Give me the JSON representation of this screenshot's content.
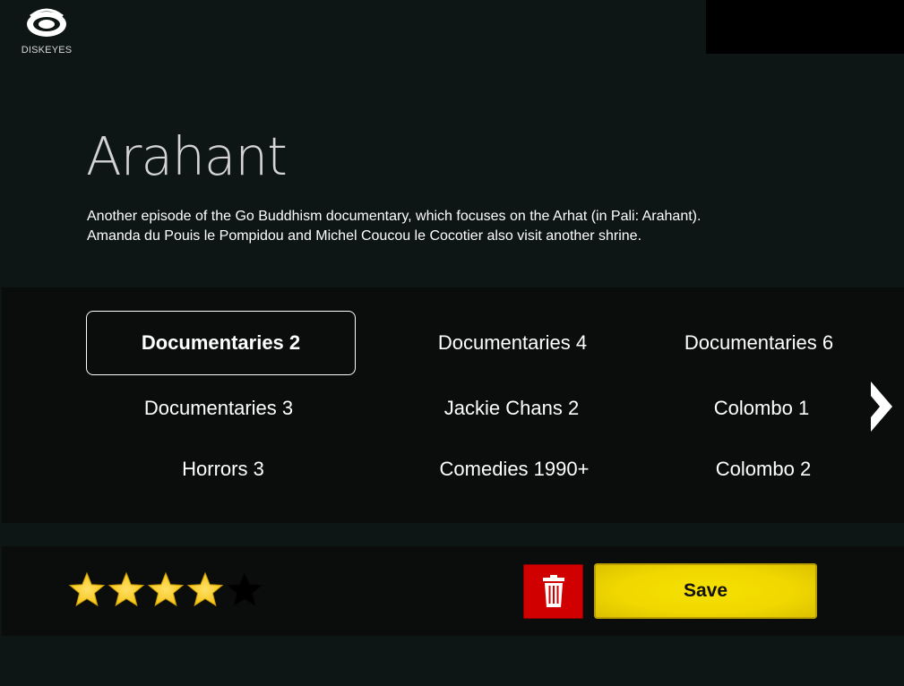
{
  "app": {
    "logo_text": "DISKEYES"
  },
  "movie": {
    "title": "Arahant",
    "description_lines": [
      "Another episode of the Go Buddhism documentary, which focuses on the Arhat (in Pali: Arahant).",
      "Amanda du Pouis le Pompidou and Michel Coucou le Cocotier also visit another shrine."
    ]
  },
  "lists": [
    {
      "label": "Documentaries 2",
      "selected": true
    },
    {
      "label": "Documentaries 4",
      "selected": false
    },
    {
      "label": "Documentaries 6",
      "selected": false
    },
    {
      "label": "Documentaries 3",
      "selected": false
    },
    {
      "label": "Jackie Chans 2",
      "selected": false
    },
    {
      "label": "Colombo 1",
      "selected": false
    },
    {
      "label": "Horrors 3",
      "selected": false
    },
    {
      "label": "Comedies 1990+",
      "selected": false
    },
    {
      "label": "Colombo 2",
      "selected": false
    }
  ],
  "rating": {
    "value": 4,
    "max": 5
  },
  "actions": {
    "save_label": "Save",
    "delete_icon": "trash-icon"
  },
  "colors": {
    "background": "#0d1515",
    "panel": "#0b0c0c",
    "star_filled": "#f5c518",
    "star_empty": "#000000",
    "delete": "#d10000",
    "save": "#f0d800"
  }
}
